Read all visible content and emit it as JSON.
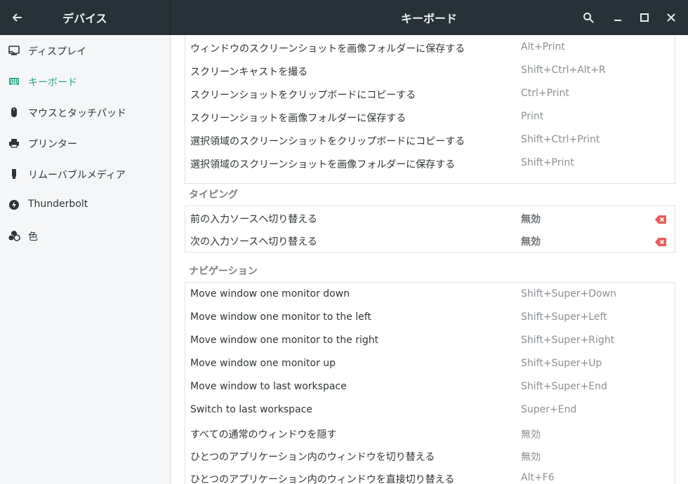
{
  "titlebar": {
    "back_icon": "back-arrow-icon",
    "left_title": "デバイス",
    "center_title": "キーボード",
    "search_icon": "search-icon",
    "minimize_icon": "minimize-icon",
    "maximize_icon": "maximize-icon",
    "close_icon": "close-icon"
  },
  "colors": {
    "accent": "#1fa68a",
    "titlebar": "#263238",
    "sidebar": "#f5f6f7",
    "reset": "#e35d5b"
  },
  "sidebar": {
    "items": [
      {
        "label": "ディスプレイ",
        "icon": "display-icon"
      },
      {
        "label": "キーボード",
        "icon": "keyboard-icon",
        "active": true
      },
      {
        "label": "マウスとタッチパッド",
        "icon": "mouse-icon"
      },
      {
        "label": "プリンター",
        "icon": "printer-icon"
      },
      {
        "label": "リムーバブルメディア",
        "icon": "removable-media-icon"
      },
      {
        "label": "Thunderbolt",
        "icon": "thunderbolt-icon"
      },
      {
        "label": "色",
        "icon": "color-icon"
      }
    ]
  },
  "screenshots": {
    "rows": [
      {
        "name": "ウィンドウのスクリーンショットを画像フォルダーに保存する",
        "accel": "Alt+Print"
      },
      {
        "name": "スクリーンキャストを撮る",
        "accel": "Shift+Ctrl+Alt+R"
      },
      {
        "name": "スクリーンショットをクリップボードにコピーする",
        "accel": "Ctrl+Print"
      },
      {
        "name": "スクリーンショットを画像フォルダーに保存する",
        "accel": "Print"
      },
      {
        "name": "選択領域のスクリーンショットをクリップボードにコピーする",
        "accel": "Shift+Ctrl+Print"
      },
      {
        "name": "選択領域のスクリーンショットを画像フォルダーに保存する",
        "accel": "Shift+Print"
      }
    ]
  },
  "typing": {
    "title": "タイピング",
    "rows": [
      {
        "name": "前の入力ソースへ切り替える",
        "accel": "無効",
        "reset_icon": "reset-shortcut-icon"
      },
      {
        "name": "次の入力ソースへ切り替える",
        "accel": "無効",
        "reset_icon": "reset-shortcut-icon"
      }
    ]
  },
  "navigation": {
    "title": "ナビゲーション",
    "rows": [
      {
        "name": "Move window one monitor down",
        "accel": "Shift+Super+Down"
      },
      {
        "name": "Move window one monitor to the left",
        "accel": "Shift+Super+Left"
      },
      {
        "name": "Move window one monitor to the right",
        "accel": "Shift+Super+Right"
      },
      {
        "name": "Move window one monitor up",
        "accel": "Shift+Super+Up"
      },
      {
        "name": "Move window to last workspace",
        "accel": "Shift+Super+End"
      },
      {
        "name": "Switch to last workspace",
        "accel": "Super+End"
      },
      {
        "name": "すべての通常のウィンドウを隠す",
        "accel": "無効"
      },
      {
        "name": "ひとつのアプリケーション内のウィンドウを切り替える",
        "accel": "無効"
      },
      {
        "name": "ひとつのアプリケーション内のウィンドウを直接切り替える",
        "accel": "Alt+F6"
      }
    ]
  }
}
